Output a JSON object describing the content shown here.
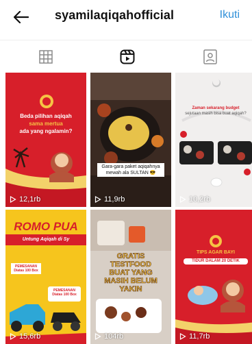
{
  "header": {
    "username": "syamilaqiqahofficial",
    "follow_label": "Ikuti"
  },
  "tabs": [
    {
      "icon": "grid-icon",
      "active": false
    },
    {
      "icon": "reels-icon",
      "active": true
    },
    {
      "icon": "tagged-icon",
      "active": false
    }
  ],
  "colors": {
    "accent": "#2f8fd8",
    "brand_red": "#d61f2c",
    "brand_yellow": "#f5c518"
  },
  "reels": [
    {
      "views": "12,1rb",
      "lines": [
        "Beda pilihan aqiqah",
        "sama mertua",
        "ada yang ngalamin?"
      ]
    },
    {
      "views": "11,9rb",
      "lines": [
        "Gara-gara paket aqiqahnya",
        "mewah ala SULTAN 😎"
      ]
    },
    {
      "views": "10,2rb",
      "lines": [
        "Zaman sekarang budget",
        "sejutaan masih bisa buat aqiqah?"
      ]
    },
    {
      "views": "15,6rb",
      "lines": [
        "ROMO PUA",
        "Untung Aqiqah di Sy",
        "PEMESANAN Diatas 100 Box",
        "PEMESANAN Diatas 100 Box"
      ]
    },
    {
      "views": "104rb",
      "lines": [
        "GRATIS",
        "TESTFOOD",
        "BUAT YANG",
        "MASIH BELUM",
        "YAKIN"
      ]
    },
    {
      "views": "11,7rb",
      "lines": [
        "TIPS AGAR BAYI",
        "TIDUR DALAM 20 DETIK"
      ]
    }
  ]
}
